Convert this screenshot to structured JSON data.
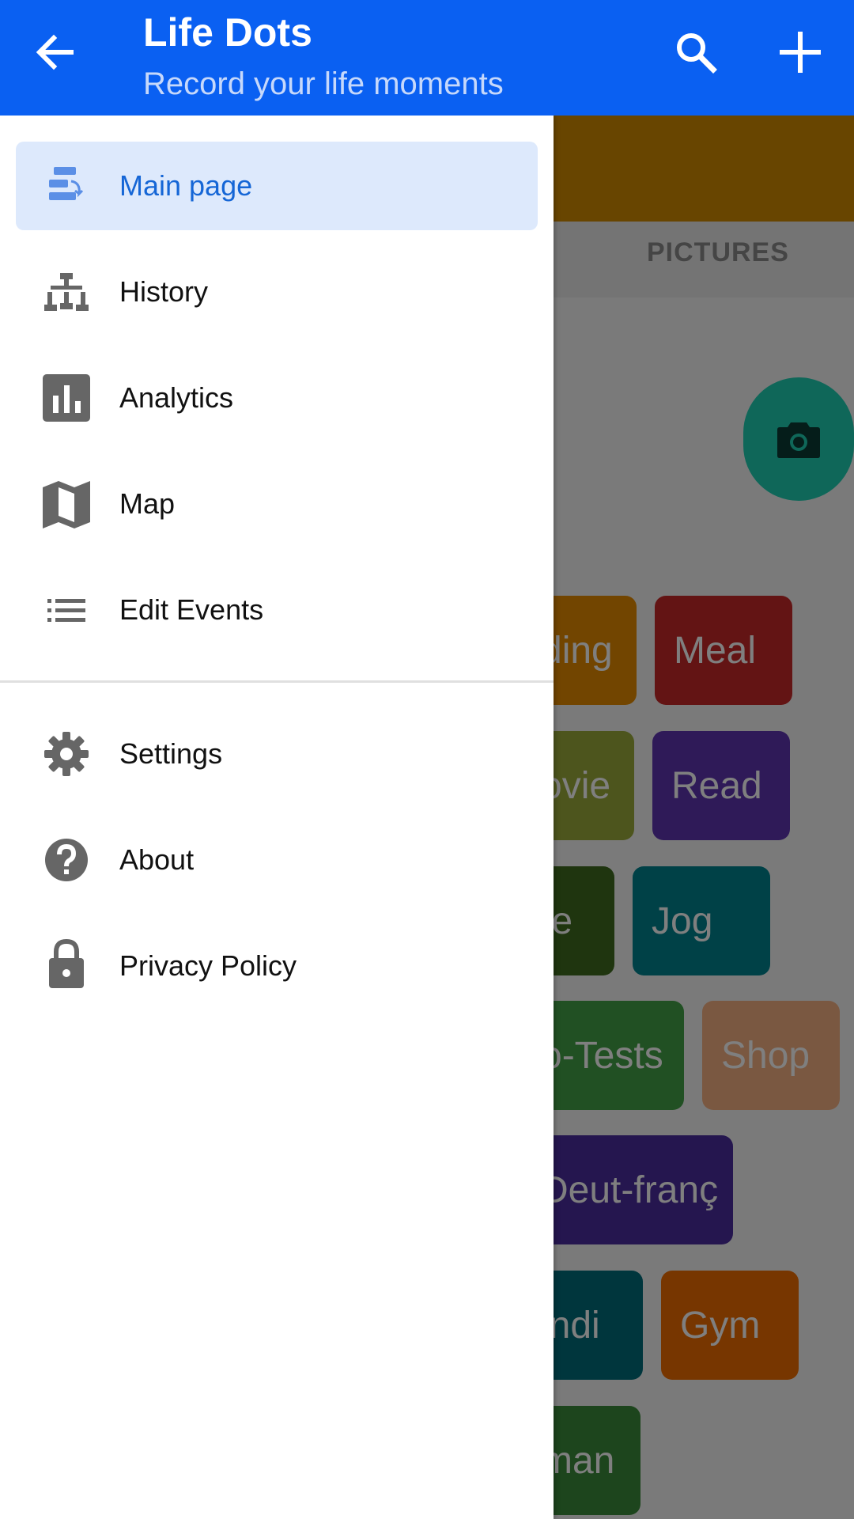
{
  "app_bar": {
    "title": "Life Dots",
    "subtitle": "Record your life moments",
    "back_icon": "arrow-back-icon",
    "search_icon": "search-icon",
    "add_icon": "add-icon",
    "color": "#0a60f2"
  },
  "drawer": {
    "items": [
      {
        "label": "Main page",
        "icon": "main-page-icon",
        "active": true
      },
      {
        "label": "History",
        "icon": "history-icon"
      },
      {
        "label": "Analytics",
        "icon": "analytics-icon"
      },
      {
        "label": "Map",
        "icon": "map-icon"
      },
      {
        "label": "Edit Events",
        "icon": "list-icon"
      }
    ],
    "secondary_items": [
      {
        "label": "Settings",
        "icon": "gear-icon"
      },
      {
        "label": "About",
        "icon": "help-icon"
      },
      {
        "label": "Privacy Policy",
        "icon": "lock-icon"
      }
    ]
  },
  "background": {
    "tab_label": "PICTURES",
    "fab_icon": "camera-icon",
    "chips": [
      {
        "label": "ding",
        "color": "#e58a00"
      },
      {
        "label": "Meal",
        "color": "#c62828"
      },
      {
        "label": "ovie",
        "color": "#9aaa3a"
      },
      {
        "label": "Read",
        "color": "#5e35b1"
      },
      {
        "label": "te",
        "color": "#3e6b1e"
      },
      {
        "label": "Jog",
        "color": "#00838f"
      },
      {
        "label": "o-Tests",
        "color": "#43a047"
      },
      {
        "label": "Shop",
        "color": "#f4b183"
      },
      {
        "label": "Deut-franç",
        "color": "#4a2d9e"
      },
      {
        "label": "indi",
        "color": "#006d7a"
      },
      {
        "label": "Gym",
        "color": "#ef6c00"
      },
      {
        "label": "man",
        "color": "#3b8a3b"
      }
    ]
  }
}
